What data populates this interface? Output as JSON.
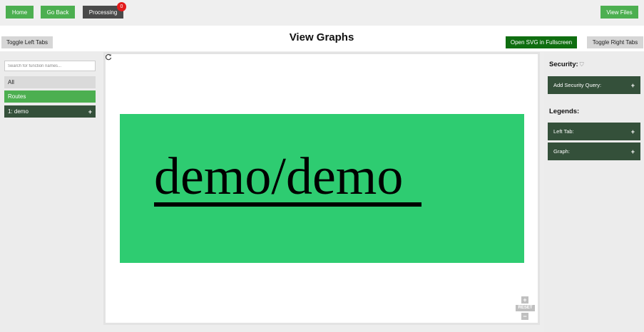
{
  "topbar": {
    "home_label": "Home",
    "back_label": "Go Back",
    "processing_label": "Processing",
    "processing_count": "0",
    "view_files_label": "View Files"
  },
  "header": {
    "toggle_left_label": "Toggle Left Tabs",
    "title": "View Graphs",
    "open_svg_label": "Open SVG in Fullscreen",
    "toggle_right_label": "Toggle Right Tabs"
  },
  "left": {
    "search_placeholder": "Search for function names...",
    "items": [
      {
        "label": "All"
      },
      {
        "label": "Routes"
      },
      {
        "label": "1: demo",
        "action": "+"
      }
    ]
  },
  "graph": {
    "node_label": "demo/demo",
    "node_color": "#2ecc71",
    "zoom_in": "+",
    "reset_label": "RESET",
    "zoom_out": "−"
  },
  "right": {
    "security_title": "Security:",
    "security_query_label": "Add Security Query:",
    "legends_title": "Legends:",
    "legend_items": [
      {
        "label": "Left Tab:",
        "action": "+"
      },
      {
        "label": "Graph:",
        "action": "+"
      }
    ],
    "security_action": "+"
  },
  "colors": {
    "accent_green": "#4caf50",
    "dark_green": "#34503a",
    "badge_red": "#e31b1b"
  }
}
